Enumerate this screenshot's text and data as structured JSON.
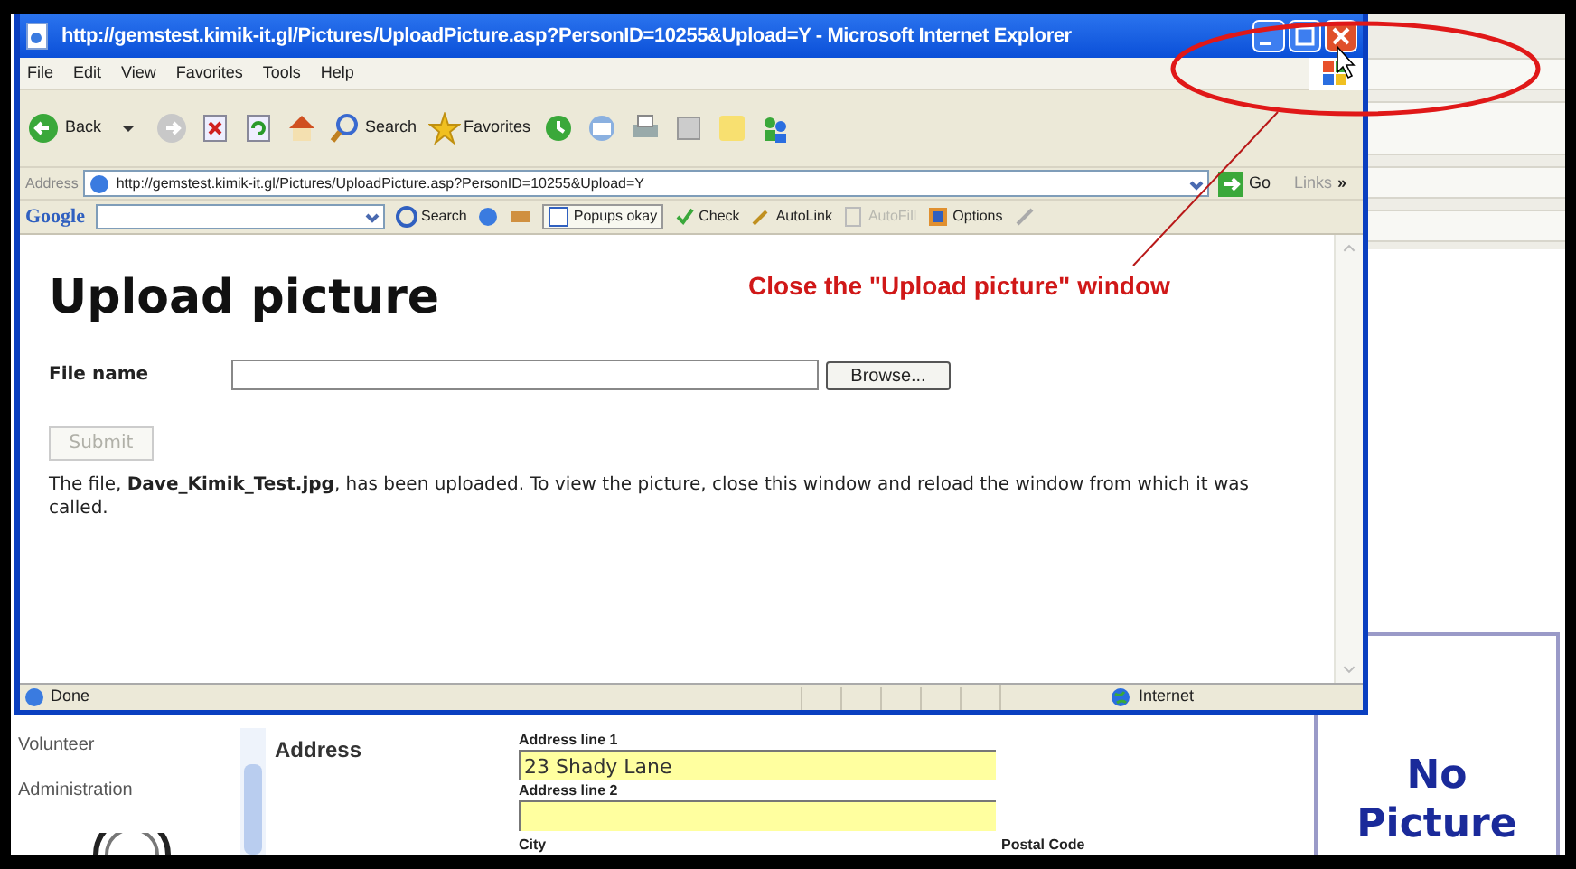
{
  "popup_window": {
    "title": "http://gemstest.kimik-it.gl/Pictures/UploadPicture.asp?PersonID=10255&Upload=Y - Microsoft Internet Explorer",
    "menu": [
      "File",
      "Edit",
      "View",
      "Favorites",
      "Tools",
      "Help"
    ],
    "toolbar": {
      "back": "Back",
      "search": "Search",
      "favorites": "Favorites"
    },
    "address_bar": {
      "label": "Address",
      "url": "http://gemstest.kimik-it.gl/Pictures/UploadPicture.asp?PersonID=10255&Upload=Y",
      "go": "Go",
      "links": "Links",
      "more": "»"
    },
    "google_bar": {
      "logo": "Google",
      "search": "Search",
      "popups": "Popups okay",
      "check": "Check",
      "autolink": "AutoLink",
      "autofill": {
        "label": "AutoFill",
        "disabled": true
      },
      "options": "Options"
    },
    "page": {
      "heading": "Upload picture",
      "file_label": "File name",
      "browse": "Browse...",
      "submit": {
        "label": "Submit",
        "disabled": true
      },
      "message": "The file, **Dave_Kimik_Test.jpg**, has been uploaded. To view the picture, close this window and reload the window from which it was called."
    },
    "status_bar": {
      "state": "Done",
      "zone": "Internet"
    }
  },
  "background_page": {
    "nav": [
      "Volunteer",
      "Administration"
    ],
    "section": "Address",
    "fields": [
      {
        "label": "Address line 1",
        "value": "23 Shady Lane"
      },
      {
        "label": "Address line 2"
      }
    ],
    "labels": [
      "City",
      "Postal Code"
    ],
    "photo_box": [
      "No",
      "Picture"
    ]
  },
  "annotation": {
    "callout": "Close the \"Upload picture\" window"
  }
}
